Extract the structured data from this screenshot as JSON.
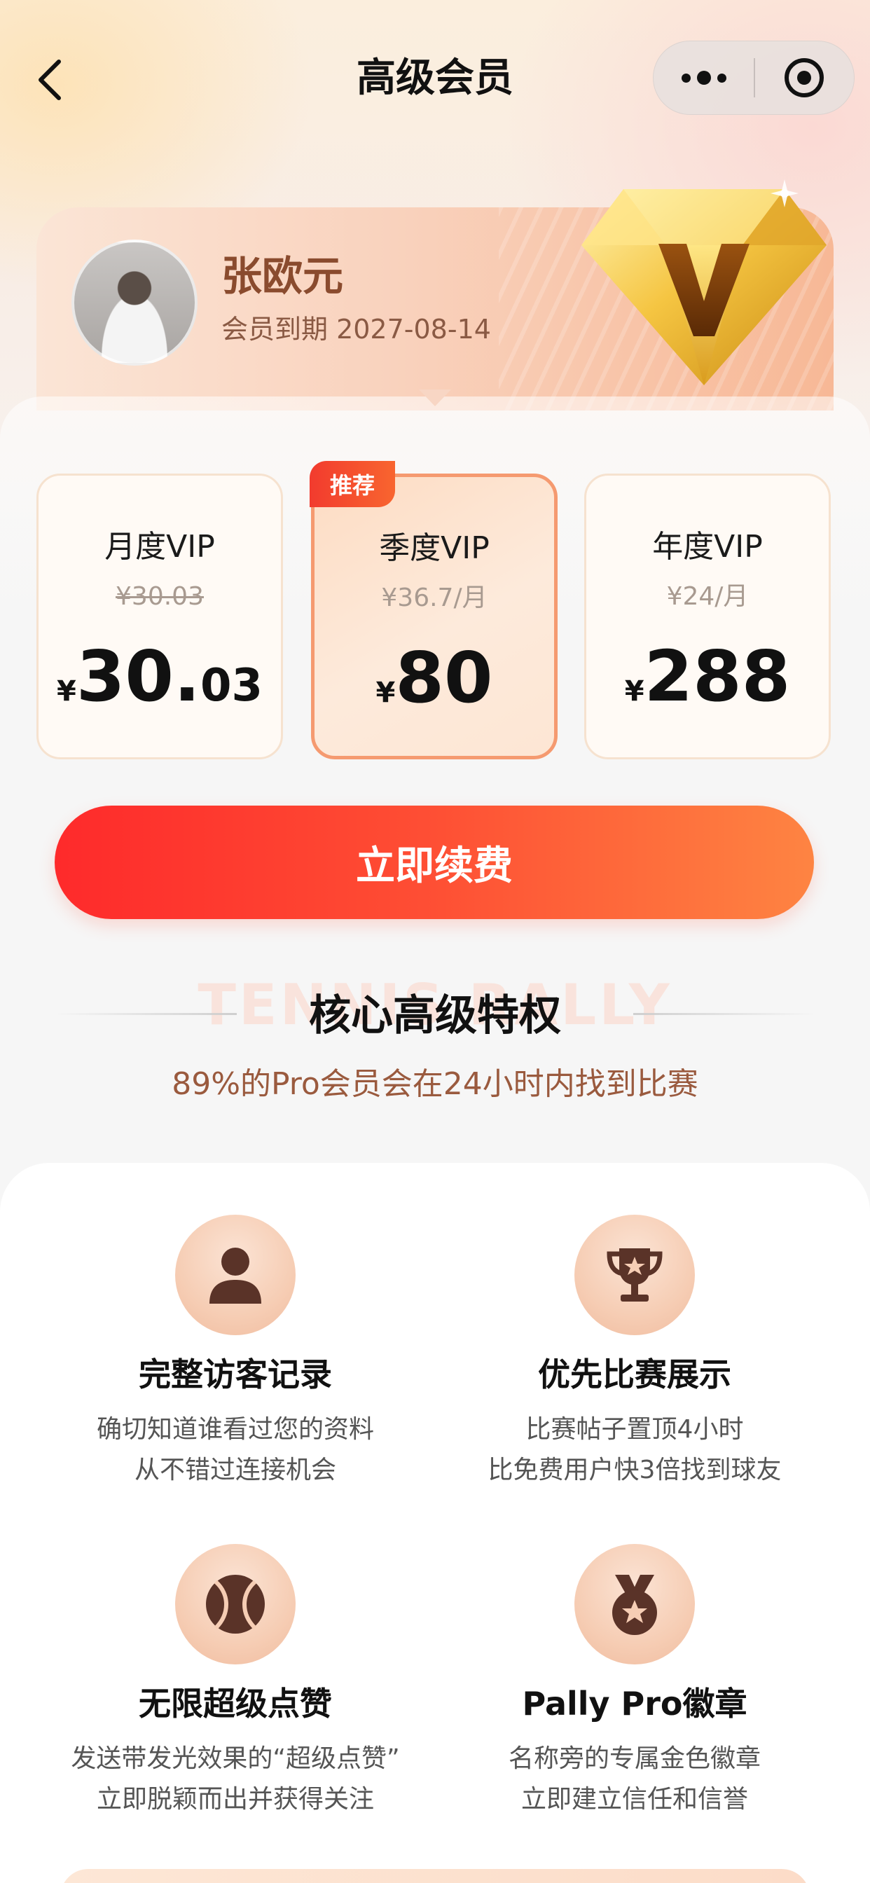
{
  "nav": {
    "title": "高级会员",
    "back_icon": "chevron-left-icon",
    "more_icon": "more-dots-icon",
    "close_icon": "target-circle-icon"
  },
  "member": {
    "name": "张欧元",
    "expire": "会员到期 2027-08-14",
    "badge_letter": "V"
  },
  "plans": [
    {
      "name": "月度VIP",
      "sub": "¥30.03",
      "sub_strike": true,
      "yen": "¥",
      "price": "30.",
      "cents": "03",
      "selected": false
    },
    {
      "name": "季度VIP",
      "sub": "¥36.7/月",
      "sub_strike": false,
      "yen": "¥",
      "price": "80",
      "cents": "",
      "selected": true
    },
    {
      "name": "年度VIP",
      "sub": "¥24/月",
      "sub_strike": false,
      "yen": "¥",
      "price": "288",
      "cents": "",
      "selected": false
    }
  ],
  "recommend_badge": "推荐",
  "renew_button": "立即续费",
  "privileges": {
    "watermark": "TENNIS RALLY",
    "title": "核心高级特权",
    "subtitle": "89%的Pro会员会在24小时内找到比赛"
  },
  "features": [
    {
      "icon": "person-icon",
      "title": "完整访客记录",
      "desc1": "确切知道谁看过您的资料",
      "desc2": "从不错过连接机会"
    },
    {
      "icon": "trophy-icon",
      "title": "优先比赛展示",
      "desc1": "比赛帖子置顶4小时",
      "desc2": "比免费用户快3倍找到球友"
    },
    {
      "icon": "tennis-ball-icon",
      "title": "无限超级点赞",
      "desc1": "发送带发光效果的“超级点赞”",
      "desc2": "立即脱颖而出并获得关注"
    },
    {
      "icon": "medal-icon",
      "title": "Pally Pro徽章",
      "desc1": "名称旁的专属金色徽章",
      "desc2": "立即建立信任和信誉"
    }
  ],
  "colors": {
    "accent": "#fe2a2b",
    "accent_end": "#fe8442",
    "icon_brown": "#5a3328",
    "selected_border": "#f59a70"
  }
}
